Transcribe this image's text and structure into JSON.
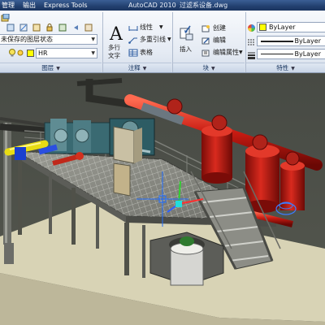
{
  "titlebar": {
    "tabs": [
      "管理",
      "输出",
      "Express Tools"
    ],
    "app_name": "AutoCAD 2010",
    "document": "过滤系设备.dwg"
  },
  "ribbon": {
    "layers": {
      "state_combo": "未保存的图层状态",
      "layer_combo": "HR",
      "panel_label": "图层"
    },
    "annotation": {
      "text_button": "多行\n文字",
      "linear_button": "线性",
      "mleader_button": "多重引线",
      "table_button": "表格",
      "panel_label": "注释"
    },
    "block": {
      "insert_button": "插入",
      "create_button": "创建",
      "edit_button": "编辑",
      "edit_attr_button": "编辑属性",
      "panel_label": "块"
    },
    "properties": {
      "color_combo": "ByLayer",
      "linetype_combo": "ByLayer",
      "lineweight_combo": "ByLayer",
      "panel_label": "特性"
    }
  },
  "colors": {
    "ribbon_label": "#15325c",
    "fire_red": "#c81b12",
    "steel_blue": "#2f6f8f",
    "platform_gray": "#8a8c84",
    "model_space": "#d8d3b5"
  }
}
